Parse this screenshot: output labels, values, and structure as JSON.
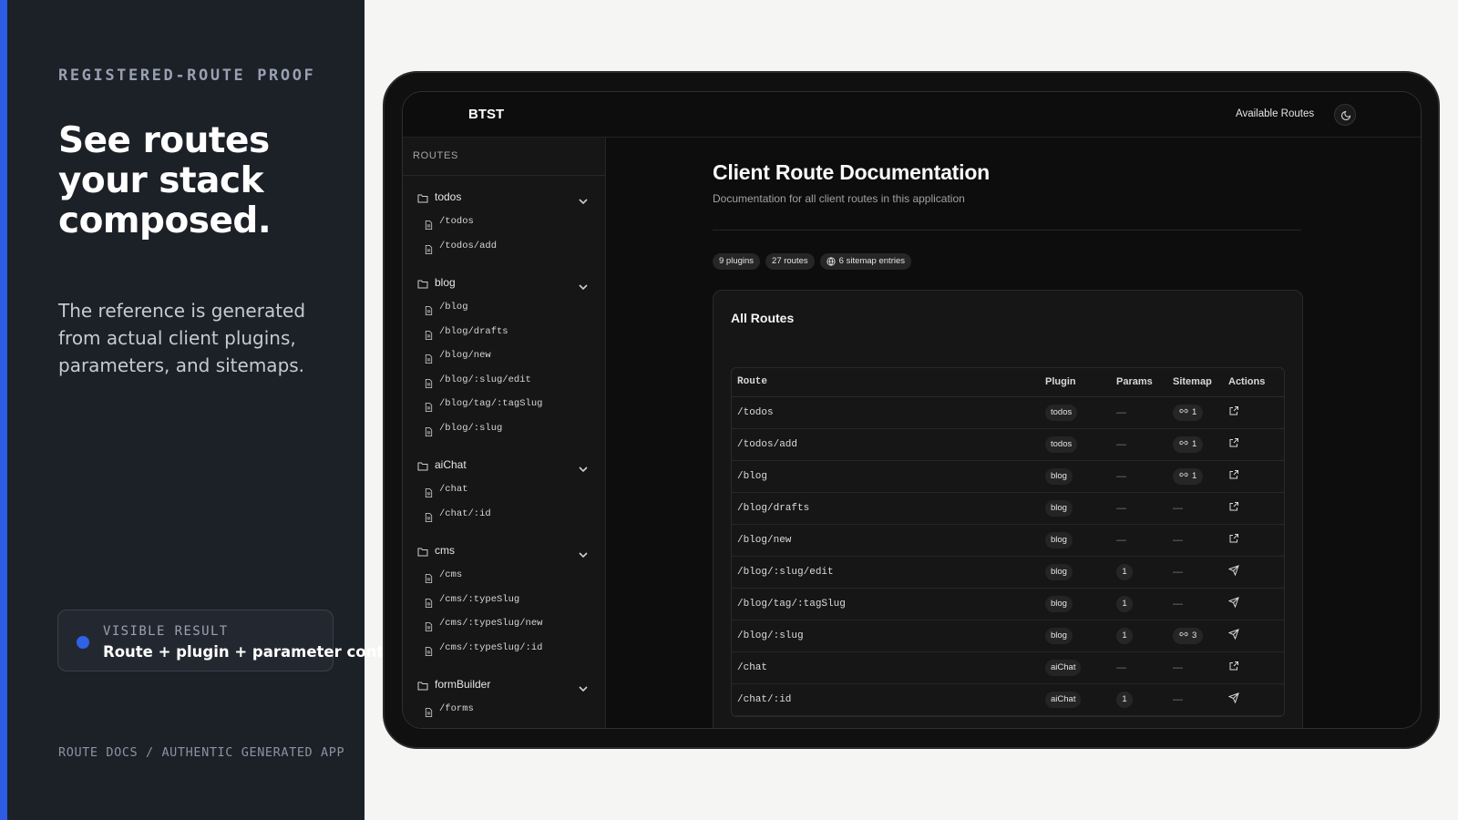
{
  "left": {
    "kicker": "REGISTERED-ROUTE PROOF",
    "headline": "See routes your stack composed.",
    "description": "The reference is generated from actual client plugins, parameters, and sitemaps.",
    "result_kicker": "VISIBLE RESULT",
    "result_text": "Route + plugin + parameter context",
    "footer": "ROUTE DOCS / AUTHENTIC GENERATED APP"
  },
  "app": {
    "brand": "BTST",
    "top_link": "Available Routes",
    "theme_icon": "moon-icon",
    "sidebar": {
      "title": "ROUTES",
      "groups": [
        {
          "label": "todos",
          "routes": [
            "/todos",
            "/todos/add"
          ]
        },
        {
          "label": "blog",
          "routes": [
            "/blog",
            "/blog/drafts",
            "/blog/new",
            "/blog/:slug/edit",
            "/blog/tag/:tagSlug",
            "/blog/:slug"
          ]
        },
        {
          "label": "aiChat",
          "routes": [
            "/chat",
            "/chat/:id"
          ]
        },
        {
          "label": "cms",
          "routes": [
            "/cms",
            "/cms/:typeSlug",
            "/cms/:typeSlug/new",
            "/cms/:typeSlug/:id"
          ]
        },
        {
          "label": "formBuilder",
          "routes": [
            "/forms"
          ]
        }
      ]
    },
    "main": {
      "title": "Client Route Documentation",
      "subtitle": "Documentation for all client routes in this application",
      "badges": {
        "plugins": "9 plugins",
        "routes": "27 routes",
        "sitemap": "6 sitemap entries"
      },
      "card_title": "All Routes",
      "columns": {
        "route": "Route",
        "plugin": "Plugin",
        "params": "Params",
        "sitemap": "Sitemap",
        "actions": "Actions"
      },
      "rows": [
        {
          "route": "/todos",
          "plugin": "todos",
          "params": "—",
          "sitemap": "1",
          "action": "external-link-icon"
        },
        {
          "route": "/todos/add",
          "plugin": "todos",
          "params": "—",
          "sitemap": "1",
          "action": "external-link-icon"
        },
        {
          "route": "/blog",
          "plugin": "blog",
          "params": "—",
          "sitemap": "1",
          "action": "external-link-icon"
        },
        {
          "route": "/blog/drafts",
          "plugin": "blog",
          "params": "—",
          "sitemap": "—",
          "action": "external-link-icon"
        },
        {
          "route": "/blog/new",
          "plugin": "blog",
          "params": "—",
          "sitemap": "—",
          "action": "external-link-icon"
        },
        {
          "route": "/blog/:slug/edit",
          "plugin": "blog",
          "params": "1",
          "sitemap": "—",
          "action": "send-icon"
        },
        {
          "route": "/blog/tag/:tagSlug",
          "plugin": "blog",
          "params": "1",
          "sitemap": "—",
          "action": "send-icon"
        },
        {
          "route": "/blog/:slug",
          "plugin": "blog",
          "params": "1",
          "sitemap": "3",
          "action": "send-icon"
        },
        {
          "route": "/chat",
          "plugin": "aiChat",
          "params": "—",
          "sitemap": "—",
          "action": "external-link-icon"
        },
        {
          "route": "/chat/:id",
          "plugin": "aiChat",
          "params": "1",
          "sitemap": "—",
          "action": "send-icon"
        }
      ]
    }
  },
  "colors": {
    "accent": "#2d5be3",
    "panel": "#1c2027",
    "app_bg": "#0d0d0d"
  }
}
